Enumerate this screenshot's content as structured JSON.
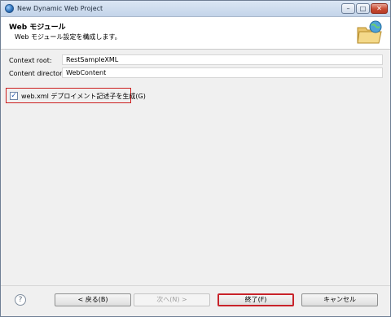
{
  "window": {
    "title": "New Dynamic Web Project",
    "controls": {
      "minimize": "–",
      "maximize": "□",
      "close": "✕"
    }
  },
  "header": {
    "title": "Web モジュール",
    "description": "Web モジュール設定を構成します。"
  },
  "form": {
    "context_root": {
      "label": "Context root:",
      "value": "RestSampleXML"
    },
    "content_directory": {
      "label": "Content directory:",
      "value": "WebContent"
    }
  },
  "checkbox": {
    "label": "web.xml デプロイメント記述子を生成(G)",
    "checked": true,
    "check_glyph": "✓"
  },
  "footer": {
    "help": "?",
    "back": "< 戻る(B)",
    "next": "次へ(N) >",
    "finish": "終了(F)",
    "cancel": "キャンセル"
  },
  "colors": {
    "highlight": "#cc1e1e",
    "titlebar": "#c3d4e9"
  }
}
